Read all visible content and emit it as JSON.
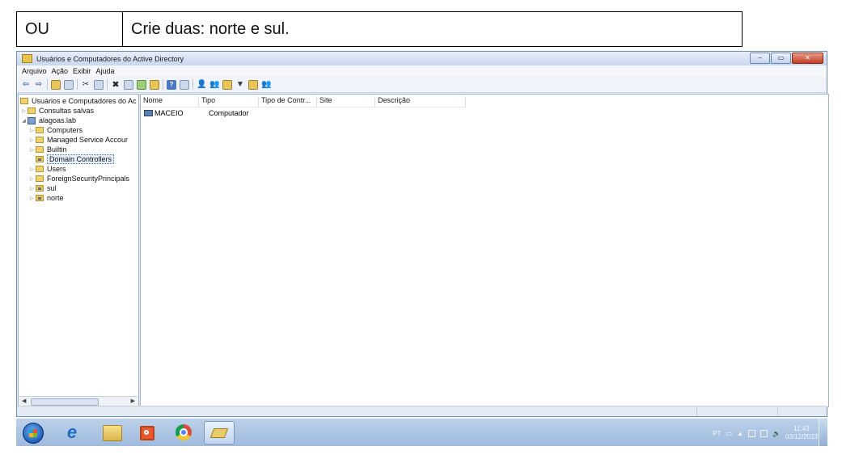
{
  "instruction": {
    "col1": "OU",
    "col2": "Crie duas: norte e sul."
  },
  "window": {
    "title": "Usuários e Computadores do Active Directory",
    "buttons": {
      "minimize": "–",
      "maximize": "▭",
      "close": "✕"
    }
  },
  "menu": [
    "Arquivo",
    "Ação",
    "Exibir",
    "Ajuda"
  ],
  "tree": {
    "root": "Usuários e Computadores do Ac",
    "saved": "Consultas salvas",
    "domain": "alagoas.lab",
    "children": [
      "Computers",
      "Managed Service Accour",
      "Builtin",
      "Domain Controllers",
      "Users",
      "ForeignSecurityPrincipals",
      "sul",
      "norte"
    ],
    "selected": "Domain Controllers"
  },
  "list": {
    "columns": [
      "Nome",
      "Tipo",
      "Tipo de Contr...",
      "Site",
      "Descrição"
    ],
    "rows": [
      {
        "name": "MACEIO",
        "type": "Computador"
      }
    ]
  },
  "taskbar": {
    "language": "PT",
    "time": "11:43",
    "date": "03/12/2023"
  }
}
